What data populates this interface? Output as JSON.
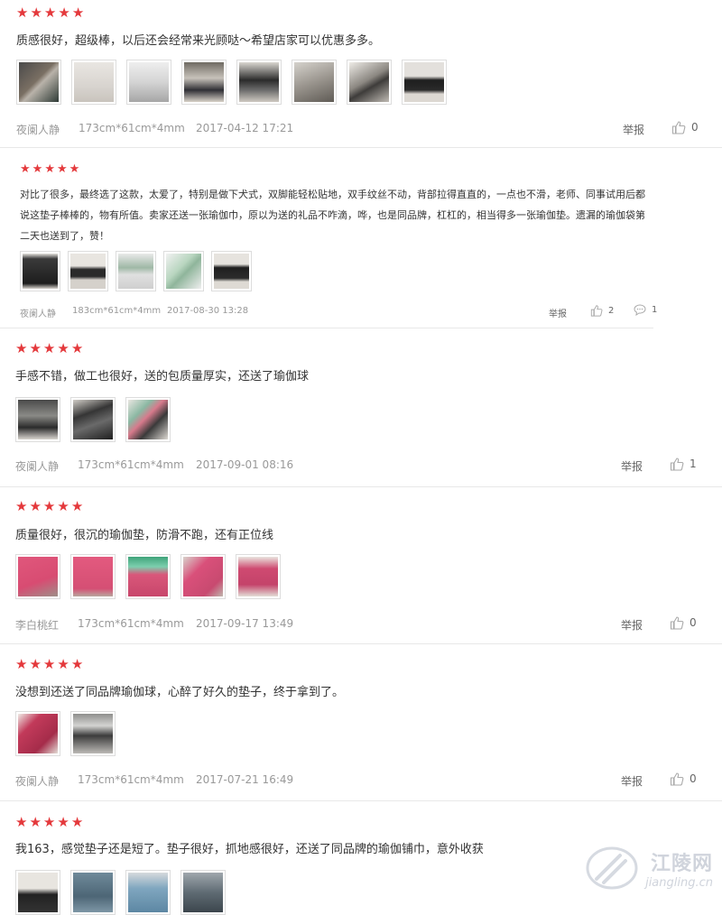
{
  "reviews": [
    {
      "stars": 5,
      "text": "质感很好，超级棒，以后还会经常来光顾哒～希望店家可以优惠多多。",
      "user": "夜阑人静",
      "size": "173cm*61cm*4mm",
      "date": "2017-04-12 17:21",
      "report": "举报",
      "likes": "0",
      "images": [
        "img-1",
        "img-2",
        "img-3",
        "img-4",
        "img-5",
        "img-6",
        "img-7",
        "img-8"
      ]
    },
    {
      "stars": 5,
      "text": "对比了很多，最终选了这款，太爱了，特别是做下犬式，双脚能轻松贴地，双手纹丝不动，背部拉得直直的，一点也不滑，老师、同事试用后都说这垫子棒棒的，物有所值。卖家还送一张瑜伽巾，原以为送的礼品不咋滴，哗，也是同品牌，杠杠的，相当得多一张瑜伽垫。遗漏的瑜伽袋第二天也送到了，赞！",
      "user": "夜阑人静",
      "size": "183cm*61cm*4mm",
      "date": "2017-08-30 13:28",
      "report": "举报",
      "likes": "2",
      "comments": "1",
      "images": [
        "img-1",
        "img-2",
        "img-3",
        "img-4",
        "img-5"
      ]
    },
    {
      "stars": 5,
      "text": "手感不错，做工也很好，送的包质量厚实，还送了瑜伽球",
      "user": "夜阑人静",
      "size": "173cm*61cm*4mm",
      "date": "2017-09-01 08:16",
      "report": "举报",
      "likes": "1",
      "images": [
        "img-1",
        "img-2",
        "img-3"
      ]
    },
    {
      "stars": 5,
      "text": "质量很好，很沉的瑜伽垫，防滑不跑，还有正位线",
      "user": "李白桃红",
      "size": "173cm*61cm*4mm",
      "date": "2017-09-17 13:49",
      "report": "举报",
      "likes": "0",
      "images": [
        "img-1",
        "img-2",
        "img-3",
        "img-4",
        "img-5"
      ]
    },
    {
      "stars": 5,
      "text": "没想到还送了同品牌瑜伽球，心醉了好久的垫子，终于拿到了。",
      "user": "夜阑人静",
      "size": "173cm*61cm*4mm",
      "date": "2017-07-21 16:49",
      "report": "举报",
      "likes": "0",
      "images": [
        "img-1",
        "img-2"
      ]
    },
    {
      "stars": 5,
      "text": "我163，感觉垫子还是短了。垫子很好，抓地感很好，还送了同品牌的瑜伽铺巾，意外收获",
      "images": [
        "img-1",
        "img-2",
        "img-3",
        "img-4"
      ]
    }
  ],
  "watermark": {
    "title": "江陵网",
    "url": "jiangling.cn"
  },
  "colors": {
    "star": "#e4393c",
    "divider": "#e8e8e8",
    "meta": "#999999"
  }
}
